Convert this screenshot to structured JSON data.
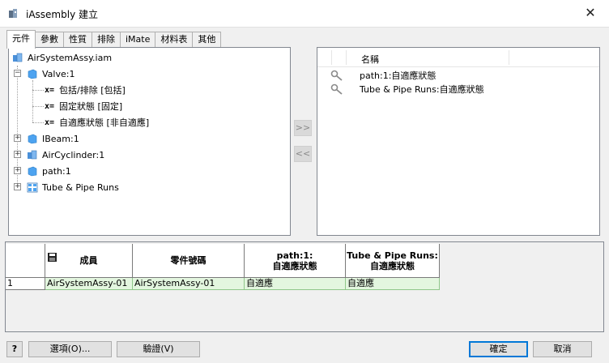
{
  "window": {
    "title": "iAssembly 建立",
    "close_glyph": "✕"
  },
  "tabs": [
    {
      "label": "元件"
    },
    {
      "label": "參數"
    },
    {
      "label": "性質"
    },
    {
      "label": "排除"
    },
    {
      "label": "iMate"
    },
    {
      "label": "材料表"
    },
    {
      "label": "其他"
    }
  ],
  "tree": {
    "root": "AirSystemAssy.iam",
    "valve": "Valve:1",
    "valve_children": [
      "包括/排除 [包括]",
      "固定狀態 [固定]",
      "自適應狀態 [非自適應]"
    ],
    "x_marker": "x=",
    "ibeam": "IBeam:1",
    "aircyl": "AirCyclinder:1",
    "path": "path:1",
    "tube": "Tube & Pipe Runs"
  },
  "arrows": {
    "add": ">>",
    "remove": "<<"
  },
  "selected": {
    "header": "名稱",
    "items": [
      "path:1:自適應狀態",
      "Tube & Pipe Runs:自適應狀態"
    ]
  },
  "table": {
    "headers": {
      "member": "成員",
      "part_number": "零件號碼",
      "col3_line1": "path:1:",
      "col3_line2": "自適應狀態",
      "col4_line1": "Tube & Pipe Runs:",
      "col4_line2": "自適應狀態"
    },
    "rows": [
      {
        "num": "1",
        "member": "AirSystemAssy-01",
        "part_number": "AirSystemAssy-01",
        "c3": "自適應",
        "c4": "自適應"
      }
    ]
  },
  "buttons": {
    "help": "?",
    "options": "選項(O)...",
    "verify": "驗證(V)",
    "ok": "確定",
    "cancel": "取消"
  }
}
